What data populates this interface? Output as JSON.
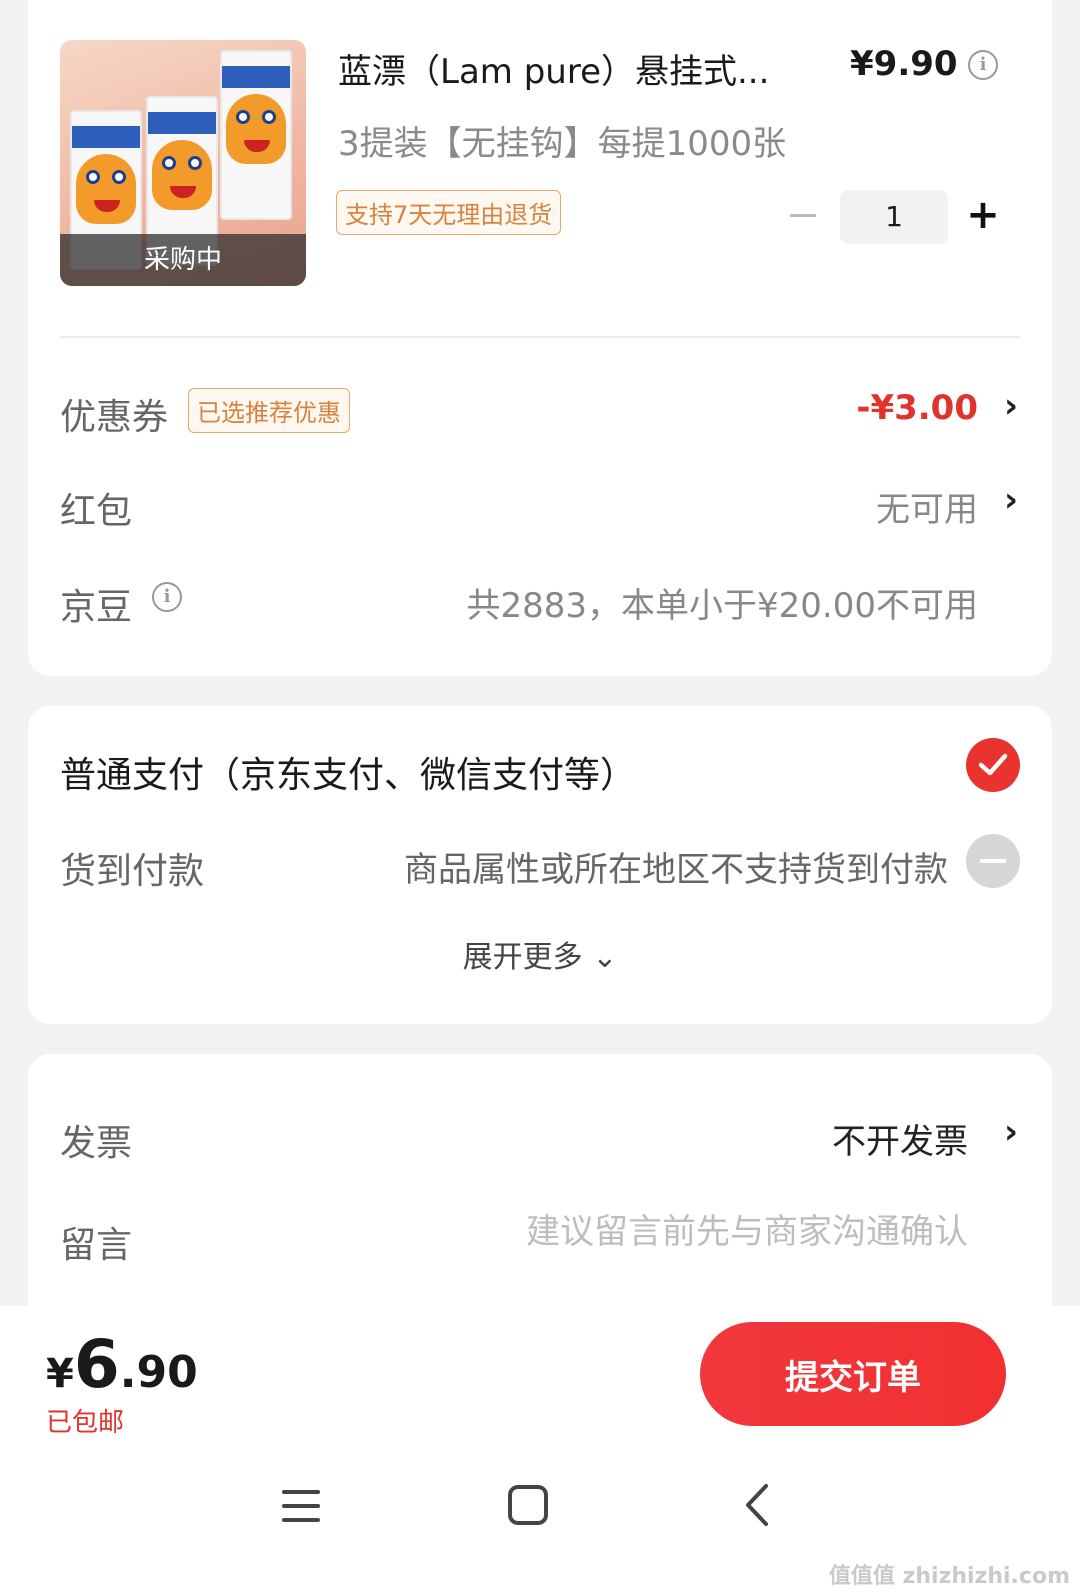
{
  "product": {
    "title": "蓝漂（Lam pure）悬挂式...",
    "price": "¥9.90",
    "spec": "3提装【无挂钩】每提1000张",
    "return_tag": "支持7天无理由退货",
    "image_status": "采购中",
    "quantity": "1",
    "quantity_minus": "−",
    "quantity_plus": "+"
  },
  "discounts": {
    "coupon_label": "优惠券",
    "coupon_tag": "已选推荐优惠",
    "coupon_value": "-¥3.00",
    "redpacket_label": "红包",
    "redpacket_value": "无可用",
    "jingdou_label": "京豆",
    "jingdou_value": "共2883，本单小于¥20.00不可用"
  },
  "payment": {
    "normal": "普通支付（京东支付、微信支付等）",
    "cod_label": "货到付款",
    "cod_value": "商品属性或所在地区不支持货到付款",
    "expand": "展开更多 ⌄"
  },
  "extras": {
    "invoice_label": "发票",
    "invoice_value": "不开发票",
    "message_label": "留言",
    "message_placeholder": "建议留言前先与商家沟通确认"
  },
  "footer": {
    "total_yen": "¥",
    "total_int": "6",
    "total_dec": ".90",
    "shipping": "已包邮",
    "submit": "提交订单"
  },
  "watermark": "值值值 zhizhizhi.com",
  "colors": {
    "accent": "#e8332e",
    "tag_orange": "#d8823e"
  },
  "icons": [
    "info-icon",
    "chevron-right-icon",
    "check-icon",
    "disabled-icon",
    "menu-icon",
    "home-icon",
    "back-icon"
  ]
}
